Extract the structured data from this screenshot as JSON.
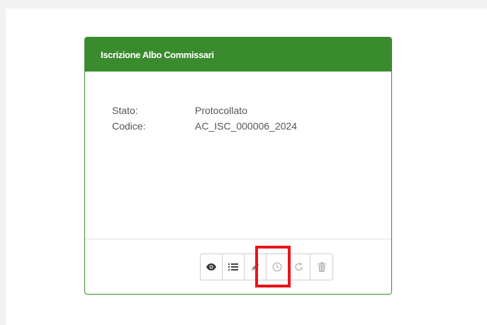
{
  "card": {
    "title": "Iscrizione Albo Commissari",
    "fields": [
      {
        "label": "Stato:",
        "value": "Protocollato"
      },
      {
        "label": "Codice:",
        "value": "AC_ISC_000006_2024"
      }
    ]
  },
  "toolbar": {
    "buttons": [
      {
        "icon": "eye-icon",
        "enabled": true
      },
      {
        "icon": "list-icon",
        "enabled": true
      },
      {
        "icon": "pencil-icon",
        "enabled": true,
        "highlighted": true
      },
      {
        "icon": "clock-icon",
        "enabled": false
      },
      {
        "icon": "redo-icon",
        "enabled": false
      },
      {
        "icon": "trash-icon",
        "enabled": false
      }
    ]
  },
  "colors": {
    "header_bg": "#3a8a2e",
    "highlight": "#e8141b",
    "text": "#555555"
  }
}
